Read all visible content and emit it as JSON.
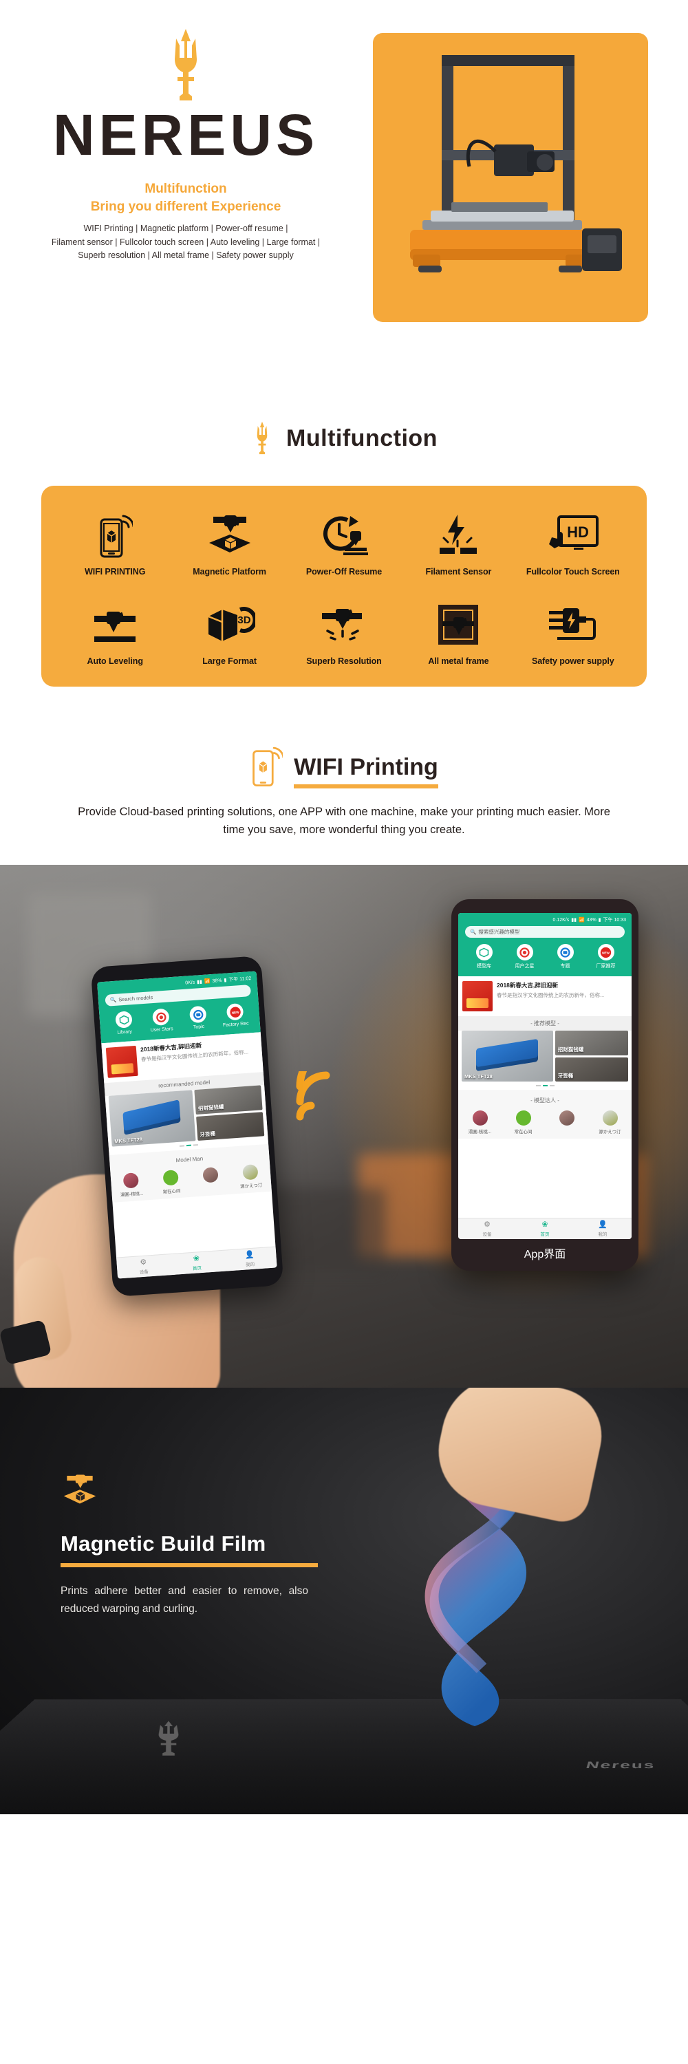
{
  "hero": {
    "brand": "NEREUS",
    "logo_icon": "trident-icon",
    "tagline_line1": "Multifunction",
    "tagline_line2": "Bring you different Experience",
    "spec_line1": "WIFI Printing | Magnetic platform | Power-off resume |",
    "spec_line2": "Filament sensor | Fullcolor touch screen | Auto leveling | Large format |",
    "spec_line3": "Superb resolution | All metal frame | Safety power supply",
    "product_image_alt": "nereus-3d-printer"
  },
  "multifunction": {
    "heading": "Multifunction",
    "heading_icon": "trident-icon",
    "features_row1": [
      {
        "label": "WIFI PRINTING",
        "icon": "phone-wifi-print-icon"
      },
      {
        "label": "Magnetic Platform",
        "icon": "magnetic-platform-icon"
      },
      {
        "label": "Power-Off Resume",
        "icon": "clock-resume-icon"
      },
      {
        "label": "Filament Sensor",
        "icon": "filament-sensor-icon"
      },
      {
        "label": "Fullcolor Touch Screen",
        "icon": "hd-touch-screen-icon"
      }
    ],
    "features_row2": [
      {
        "label": "Auto Leveling",
        "icon": "auto-leveling-icon"
      },
      {
        "label": "Large Format",
        "icon": "large-format-3d-icon"
      },
      {
        "label": "Superb Resolution",
        "icon": "superb-resolution-icon"
      },
      {
        "label": "All metal frame",
        "icon": "metal-frame-icon"
      },
      {
        "label": "Safety power supply",
        "icon": "power-supply-icon"
      }
    ]
  },
  "wifi_printing": {
    "heading": "WIFI Printing",
    "heading_icon": "phone-wifi-print-icon",
    "body": "Provide Cloud-based printing solutions, one APP with one machine, make your printing much easier.  More time you save, more wonderful thing you create.",
    "caption": "App界面"
  },
  "app_held": {
    "status_speed": "0K/s",
    "status_battery": "38%",
    "status_time": "下午 11:02",
    "search_placeholder": "Search models",
    "search_icon": "search-icon",
    "quick_actions": [
      {
        "label": "Library",
        "icon": "library-icon"
      },
      {
        "label": "User Stars",
        "icon": "user-stars-icon"
      },
      {
        "label": "Topic",
        "icon": "topic-icon"
      },
      {
        "label": "Factory Rec",
        "icon": "factory-recommend-icon"
      }
    ],
    "news_title": "2018新春大吉,辞旧迎新",
    "news_desc": "春节是指汉字文化圈传统上的农历新年，俗称...",
    "section_label": "recommanded model",
    "tile_main": "MKS TFT28",
    "tile_a": "招财猫钱罐",
    "tile_b": "牙签桶",
    "makers_label": "Model Man",
    "makers": [
      "湯圓-核桃...",
      "常在心间",
      "",
      "源かえつ汀"
    ],
    "tabs": [
      {
        "label": "设备",
        "icon": "device-icon",
        "active": false
      },
      {
        "label": "首页",
        "icon": "home-icon",
        "active": true
      },
      {
        "label": "我的",
        "icon": "profile-icon",
        "active": false
      }
    ]
  },
  "app_float": {
    "status_speed": "0.12K/s",
    "status_battery": "43%",
    "status_time": "下午 10:33",
    "search_placeholder": "搜索感兴趣的模型",
    "search_icon": "search-icon",
    "quick_actions": [
      {
        "label": "模型库",
        "icon": "library-icon"
      },
      {
        "label": "用户之星",
        "icon": "user-stars-icon"
      },
      {
        "label": "专题",
        "icon": "topic-icon"
      },
      {
        "label": "厂家推荐",
        "icon": "factory-recommend-icon"
      }
    ],
    "news_title": "2018新春大吉,辞旧迎新",
    "news_desc": "春节是指汉字文化圈传统上的农历新年，俗称...",
    "section_label": "- 推荐模型 -",
    "tile_main": "MKS TFT28",
    "tile_a": "招财猫钱罐",
    "tile_b": "牙签桶",
    "makers_label": "- 模型达人 -",
    "makers": [
      "湯圓-核桃...",
      "常在心间",
      "",
      "源かえつ汀"
    ],
    "tabs": [
      {
        "label": "设备",
        "icon": "device-icon",
        "active": false
      },
      {
        "label": "首页",
        "icon": "home-icon",
        "active": true
      },
      {
        "label": "我的",
        "icon": "profile-icon",
        "active": false
      }
    ]
  },
  "magnetic_film": {
    "heading": "Magnetic Build Film",
    "heading_icon": "magnetic-platform-icon",
    "body": "Prints adhere better and easier to remove, also reduced warping and curling.",
    "watermark": "Nereus"
  },
  "colors": {
    "brand_orange": "#f5ab3e",
    "accent_orange": "#f5a83a",
    "dark_text": "#2b211f",
    "app_green": "#15b48a",
    "dark_bg": "#1b1b1d"
  }
}
